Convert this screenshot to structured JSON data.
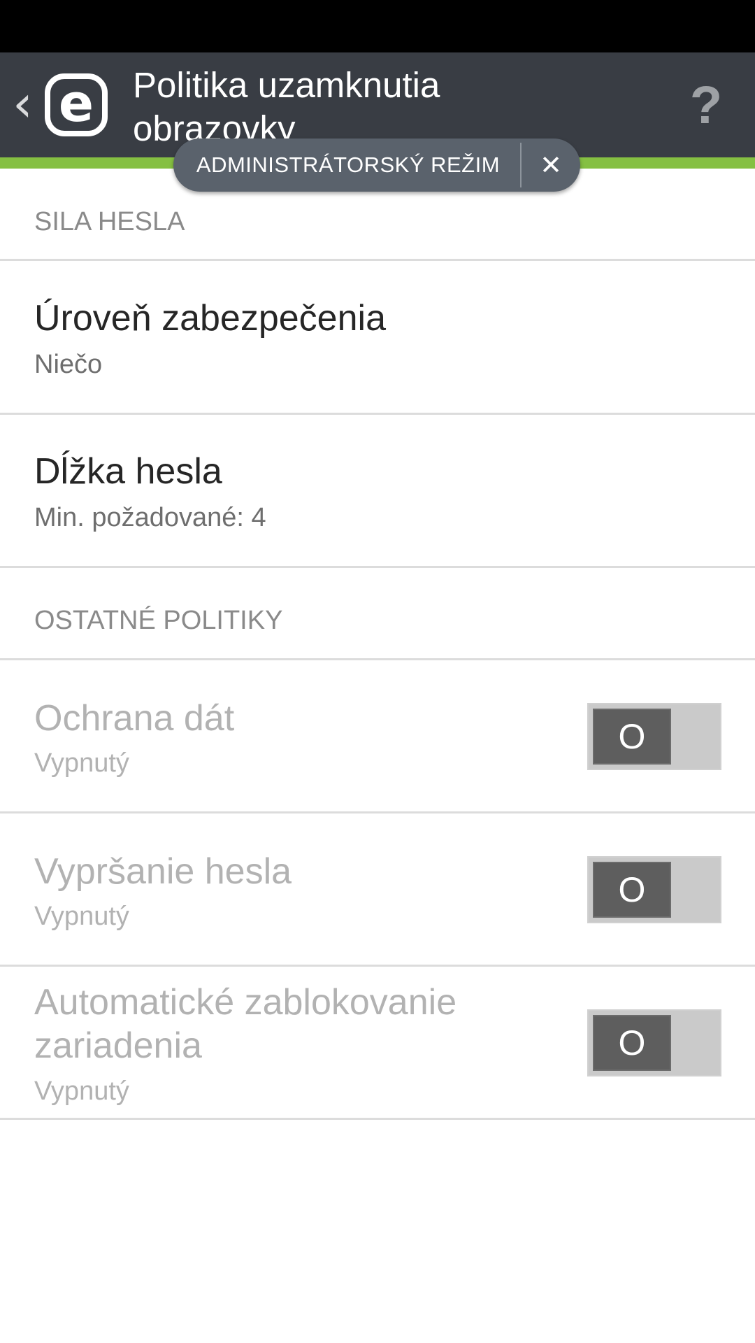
{
  "action_bar": {
    "back_icon": "chevron-left-icon",
    "logo_icon": "eset-e-logo",
    "logo_letter": "e",
    "title": "Politika uzamknutia obrazovky",
    "help_icon": "question-mark-icon",
    "help_label": "?"
  },
  "admin_banner": {
    "label": "ADMINISTRÁTORSKÝ REŽIM",
    "close_icon": "close-icon",
    "close_label": "✕"
  },
  "colors": {
    "action_bar": "#393d44",
    "accent": "#85c042",
    "pill": "#5a626c"
  },
  "sections": {
    "password_strength": {
      "header": "SILA HESLA",
      "items": [
        {
          "title": "Úroveň zabezpečenia",
          "summary": "Niečo"
        },
        {
          "title": "Dĺžka hesla",
          "summary": "Min. požadované: 4"
        }
      ]
    },
    "other_policies": {
      "header": "OSTATNÉ POLITIKY",
      "items": [
        {
          "title": "Ochrana dát",
          "summary": "Vypnutý",
          "toggle": "O",
          "enabled": false
        },
        {
          "title": "Vypršanie hesla",
          "summary": "Vypnutý",
          "toggle": "O",
          "enabled": false
        },
        {
          "title": "Automatické zablokovanie zariadenia",
          "summary": "Vypnutý",
          "toggle": "O",
          "enabled": false
        }
      ]
    }
  }
}
